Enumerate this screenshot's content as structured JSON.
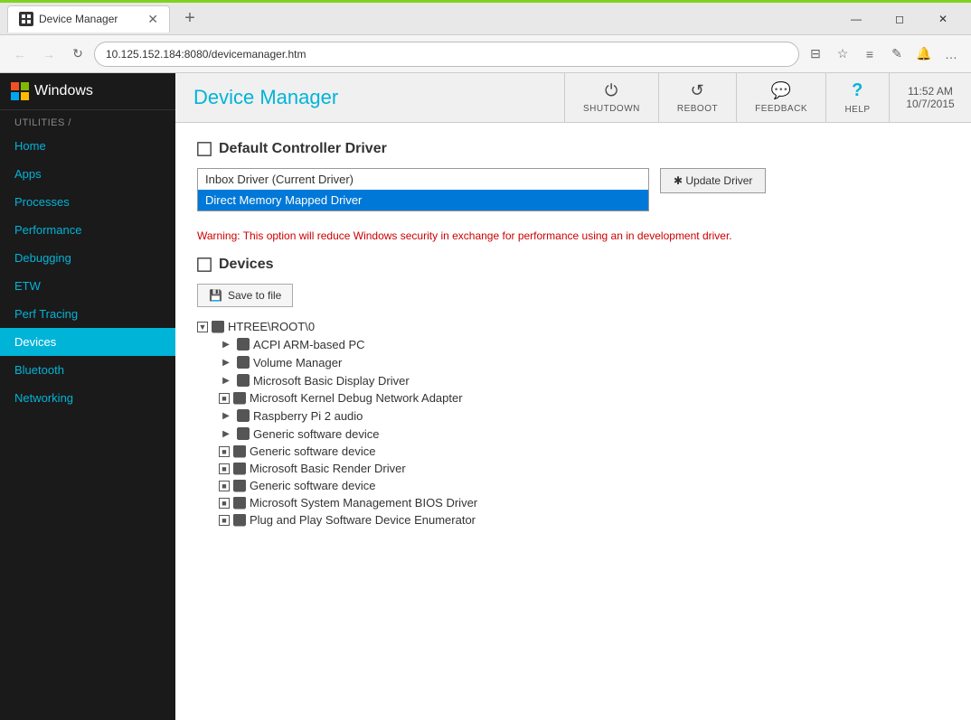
{
  "browser": {
    "tab_title": "Device Manager",
    "url": "10.125.152.184:8080/devicemanager.htm",
    "new_tab_symbol": "+",
    "window_controls": {
      "minimize": "—",
      "maximize": "◻",
      "close": "✕"
    },
    "nav": {
      "back": "←",
      "forward": "→",
      "refresh": "↻"
    }
  },
  "sidebar": {
    "brand": "Windows",
    "section_label": "UTILITIES /",
    "items": [
      {
        "id": "home",
        "label": "Home"
      },
      {
        "id": "apps",
        "label": "Apps"
      },
      {
        "id": "processes",
        "label": "Processes"
      },
      {
        "id": "performance",
        "label": "Performance"
      },
      {
        "id": "debugging",
        "label": "Debugging"
      },
      {
        "id": "etw",
        "label": "ETW"
      },
      {
        "id": "perf-tracing",
        "label": "Perf Tracing"
      },
      {
        "id": "devices",
        "label": "Devices"
      },
      {
        "id": "bluetooth",
        "label": "Bluetooth"
      },
      {
        "id": "networking",
        "label": "Networking"
      }
    ]
  },
  "topbar": {
    "page_title": "Device Manager",
    "actions": [
      {
        "id": "shutdown",
        "label": "SHUTDOWN",
        "icon": "⏻"
      },
      {
        "id": "reboot",
        "label": "REBOOT",
        "icon": "↺"
      },
      {
        "id": "feedback",
        "label": "FEEDBACK",
        "icon": "💬"
      },
      {
        "id": "help",
        "label": "HELP",
        "icon": "?"
      }
    ],
    "time": "11:52 AM",
    "date": "10/7/2015"
  },
  "content": {
    "driver_section_title": "Default Controller Driver",
    "driver_options": [
      {
        "id": "inbox",
        "label": "Inbox Driver (Current Driver)",
        "selected": false
      },
      {
        "id": "direct-memory",
        "label": "Direct Memory Mapped Driver",
        "selected": true
      }
    ],
    "update_driver_btn": "✱ Update Driver",
    "warning_text": "Warning: This option will reduce Windows security in exchange for performance using an in development driver.",
    "devices_section_title": "Devices",
    "save_to_file_btn": "Save to file",
    "device_tree": {
      "root": {
        "label": "HTREE\\ROOT\\0",
        "expanded": true,
        "children": [
          {
            "label": "ACPI ARM-based PC",
            "has_children": true,
            "expanded": false,
            "square": false
          },
          {
            "label": "Volume Manager",
            "has_children": true,
            "expanded": false,
            "square": false
          },
          {
            "label": "Microsoft Basic Display Driver",
            "has_children": true,
            "expanded": false,
            "square": false
          },
          {
            "label": "Microsoft Kernel Debug Network Adapter",
            "has_children": false,
            "expanded": false,
            "square": true
          },
          {
            "label": "Raspberry Pi 2 audio",
            "has_children": true,
            "expanded": false,
            "square": false
          },
          {
            "label": "Generic software device",
            "has_children": true,
            "expanded": false,
            "square": false
          },
          {
            "label": "Generic software device",
            "has_children": false,
            "expanded": false,
            "square": true
          },
          {
            "label": "Microsoft Basic Render Driver",
            "has_children": false,
            "expanded": false,
            "square": true
          },
          {
            "label": "Generic software device",
            "has_children": false,
            "expanded": false,
            "square": true
          },
          {
            "label": "Microsoft System Management BIOS Driver",
            "has_children": false,
            "expanded": false,
            "square": true
          },
          {
            "label": "Plug and Play Software Device Enumerator",
            "has_children": false,
            "expanded": false,
            "square": true
          }
        ]
      }
    }
  }
}
